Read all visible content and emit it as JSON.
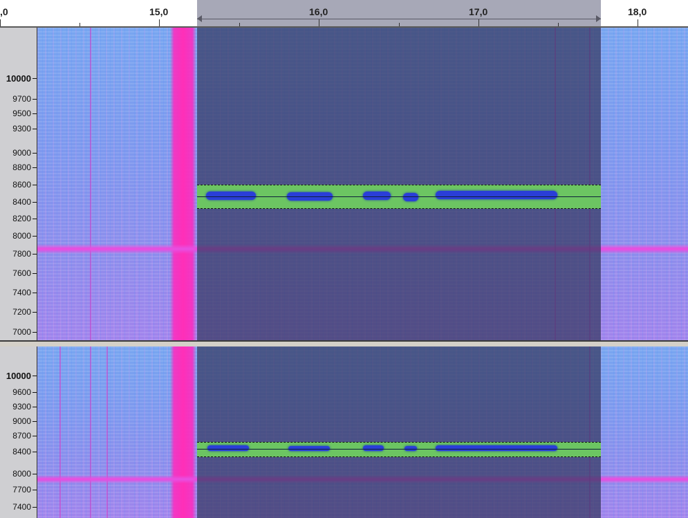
{
  "ruler": {
    "labels": [
      ",0",
      "15,0",
      "16,0",
      "17,0",
      "18,0"
    ]
  },
  "track1": {
    "freq_labels": [
      "10000",
      "9700",
      "9500",
      "9300",
      "9000",
      "8800",
      "8600",
      "8400",
      "8200",
      "8000",
      "7800",
      "7600",
      "7400",
      "7200",
      "7000"
    ]
  },
  "track2": {
    "freq_labels": [
      "10000",
      "9600",
      "9300",
      "9000",
      "8700",
      "8400",
      "8000",
      "7700",
      "7400"
    ]
  },
  "colors": {
    "selection_band": "#6cc562",
    "selection_overlay": "#343860",
    "spectrum_base": "#7e98ee",
    "pink_noise": "#ff2fb8",
    "signal_blob": "#2a3ed8"
  }
}
